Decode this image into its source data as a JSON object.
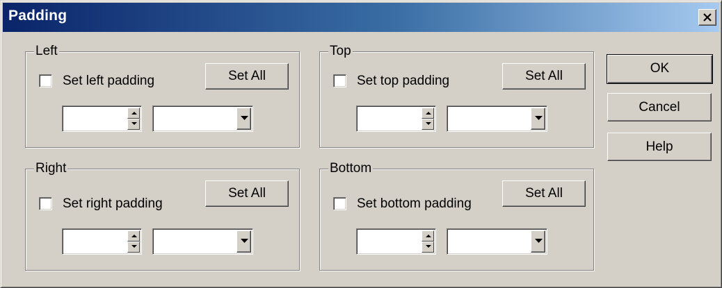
{
  "window": {
    "title": "Padding"
  },
  "groups": {
    "left": {
      "label": "Left",
      "checkbox_label": "Set left padding",
      "checked": false,
      "set_all_label": "Set All",
      "value": "",
      "unit": ""
    },
    "top": {
      "label": "Top",
      "checkbox_label": "Set top padding",
      "checked": false,
      "set_all_label": "Set All",
      "value": "",
      "unit": ""
    },
    "right": {
      "label": "Right",
      "checkbox_label": "Set right padding",
      "checked": false,
      "set_all_label": "Set All",
      "value": "",
      "unit": ""
    },
    "bottom": {
      "label": "Bottom",
      "checkbox_label": "Set bottom padding",
      "checked": false,
      "set_all_label": "Set All",
      "value": "",
      "unit": ""
    }
  },
  "buttons": {
    "ok": "OK",
    "cancel": "Cancel",
    "help": "Help"
  },
  "colors": {
    "face": "#d4d0c8",
    "title_start": "#0a246a",
    "title_end": "#a6caf0"
  },
  "icons": {
    "close": "close-icon",
    "spin_up": "arrow-up-icon",
    "spin_down": "arrow-down-icon",
    "dropdown": "chevron-down-icon"
  }
}
